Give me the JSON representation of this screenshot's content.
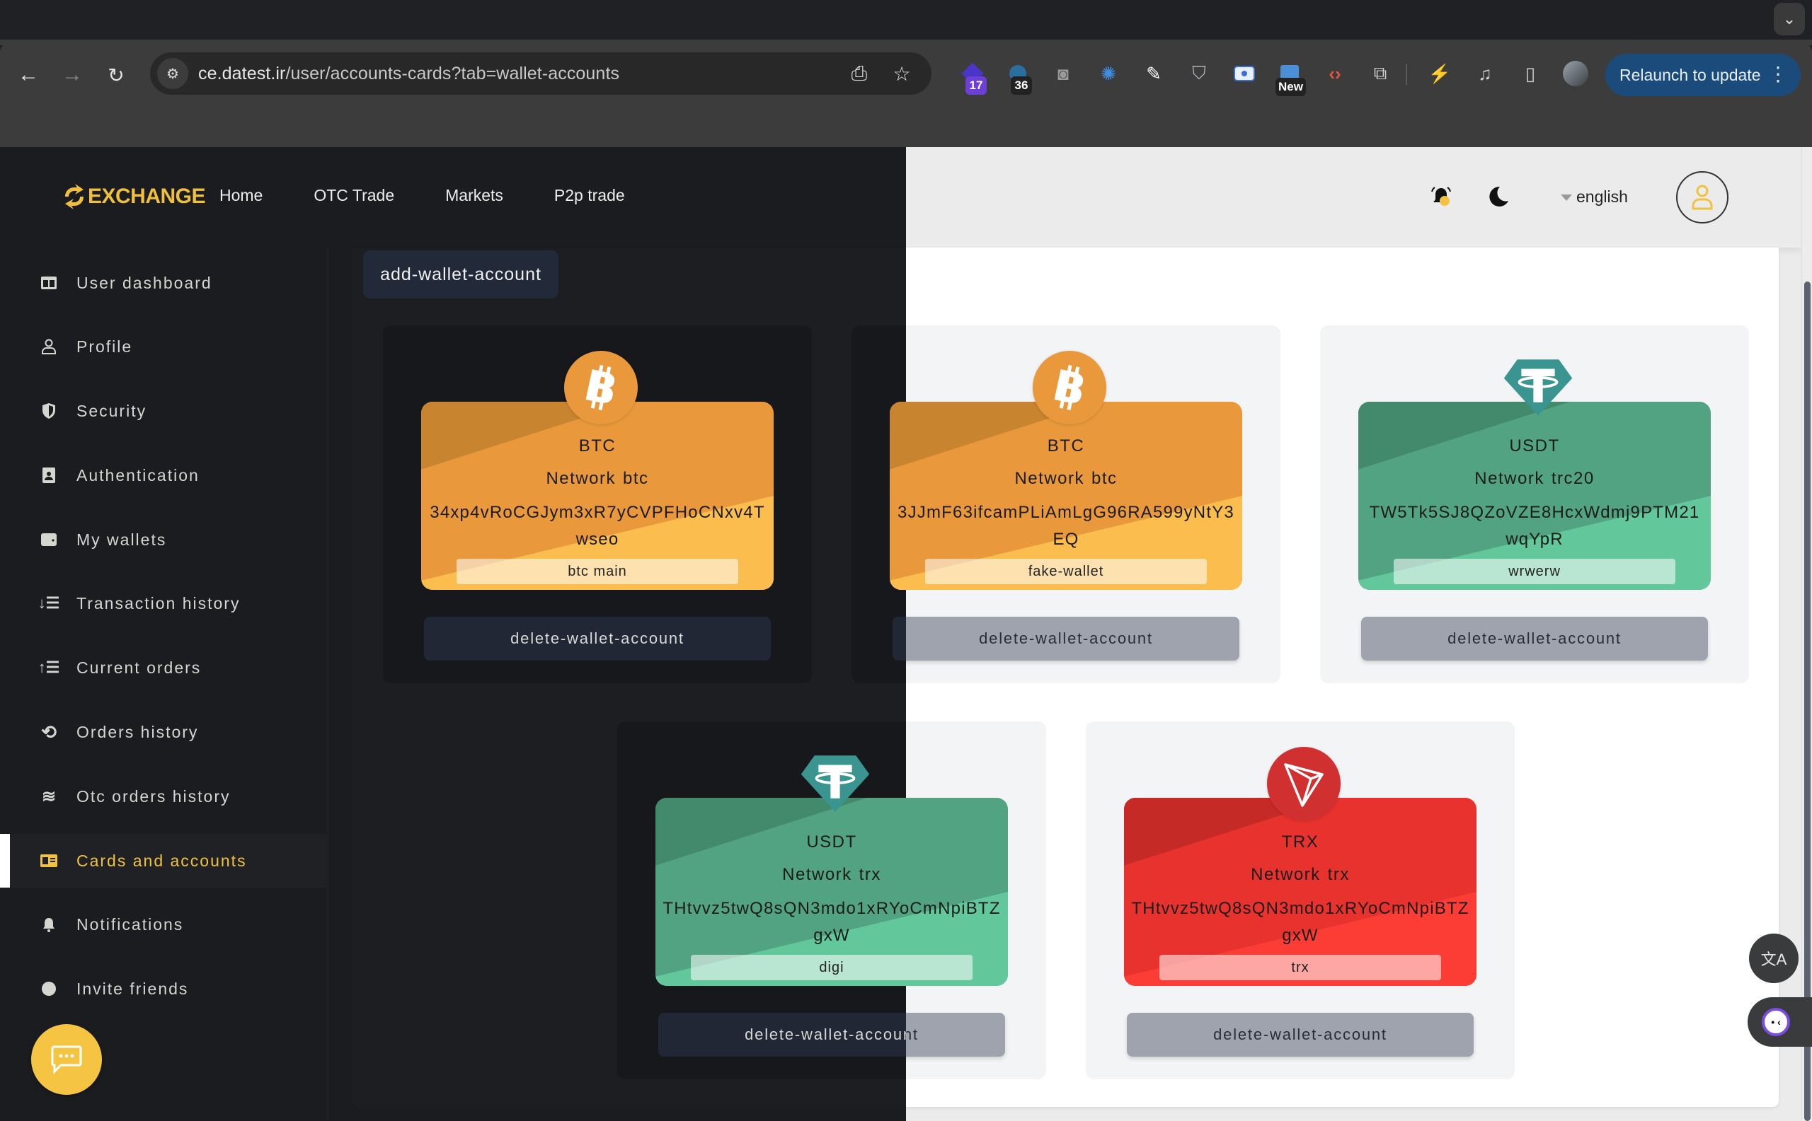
{
  "browser": {
    "url_host": "ce.datest.ir",
    "url_path": "/user/accounts-cards?tab=wallet-accounts",
    "relaunch_label": "Relaunch to update",
    "extensions": [
      {
        "name": "ext-1-icon",
        "badge": "17"
      },
      {
        "name": "ext-2-icon",
        "badge": "36"
      },
      {
        "name": "camera-ext-icon",
        "badge": ""
      },
      {
        "name": "aperture-ext-icon",
        "badge": ""
      },
      {
        "name": "eyedropper-ext-icon",
        "badge": ""
      },
      {
        "name": "shield-ext-icon",
        "badge": ""
      },
      {
        "name": "record-ext-icon",
        "badge": ""
      },
      {
        "name": "new-ext-icon",
        "badge": "New"
      },
      {
        "name": "code-ext-icon",
        "badge": ""
      },
      {
        "name": "puzzle-extensions-icon",
        "badge": ""
      }
    ]
  },
  "header": {
    "logo_text": "EXCHANGE",
    "nav": [
      "Home",
      "OTC Trade",
      "Markets",
      "P2p trade"
    ],
    "language": "english"
  },
  "sidebar": {
    "items": [
      {
        "label": "User dashboard",
        "icon": "dashboard-icon",
        "active": false
      },
      {
        "label": "Profile",
        "icon": "profile-icon",
        "active": false
      },
      {
        "label": "Security",
        "icon": "shield-icon",
        "active": false
      },
      {
        "label": "Authentication",
        "icon": "id-badge-icon",
        "active": false
      },
      {
        "label": "My wallets",
        "icon": "wallet-icon",
        "active": false
      },
      {
        "label": "Transaction history",
        "icon": "sort-down-icon",
        "active": false
      },
      {
        "label": "Current orders",
        "icon": "sort-up-icon",
        "active": false
      },
      {
        "label": "Orders history",
        "icon": "history-icon",
        "active": false
      },
      {
        "label": "Otc orders history",
        "icon": "layers-icon",
        "active": false
      },
      {
        "label": "Cards and accounts",
        "icon": "id-card-icon",
        "active": true
      },
      {
        "label": "Notifications",
        "icon": "bell-icon",
        "active": false
      },
      {
        "label": "Invite friends",
        "icon": "invite-icon",
        "active": false
      }
    ]
  },
  "main": {
    "add_button": "add-wallet-account",
    "delete_label": "delete-wallet-account",
    "network_label": "Network",
    "wallets": [
      {
        "symbol": "BTC",
        "network": "btc",
        "address": "34xp4vRoCGJym3xR7yCVPFHoCNxv4Twseo",
        "tag": "btc main",
        "coin": "btc",
        "colors": {
          "base": "#e9993c",
          "dark": "#c98430",
          "light": "#fbbd4e",
          "coin": "#e9993c"
        }
      },
      {
        "symbol": "BTC",
        "network": "btc",
        "address": "3JJmF63ifcamPLiAmLgG96RA599yNtY3EQ",
        "tag": "fake-wallet",
        "coin": "btc",
        "colors": {
          "base": "#e9993c",
          "dark": "#c98430",
          "light": "#fbbd4e",
          "coin": "#e9993c"
        }
      },
      {
        "symbol": "USDT",
        "network": "trc20",
        "address": "TW5Tk5SJ8QZoVZE8HcxWdmj9PTM21wqYpR",
        "tag": "wrwerw",
        "coin": "usdt",
        "colors": {
          "base": "#52a381",
          "dark": "#43896b",
          "light": "#62c89b",
          "coin": "#3a9590"
        }
      },
      {
        "symbol": "USDT",
        "network": "trx",
        "address": "THtvvz5twQ8sQN3mdo1xRYoCmNpiBTZgxW",
        "tag": "digi",
        "coin": "usdt",
        "colors": {
          "base": "#52a381",
          "dark": "#43896b",
          "light": "#62c89b",
          "coin": "#3a9590"
        }
      },
      {
        "symbol": "TRX",
        "network": "trx",
        "address": "THtvvz5twQ8sQN3mdo1xRYoCmNpiBTZgxW",
        "tag": "trx",
        "coin": "trx",
        "colors": {
          "base": "#e8322d",
          "dark": "#c62a26",
          "light": "#fb3d35",
          "coin": "#d03030"
        }
      }
    ]
  },
  "colors": {
    "accent": "#f0c240",
    "dark_bg": "#1b1c1f",
    "light_bg": "#ebebeb"
  }
}
